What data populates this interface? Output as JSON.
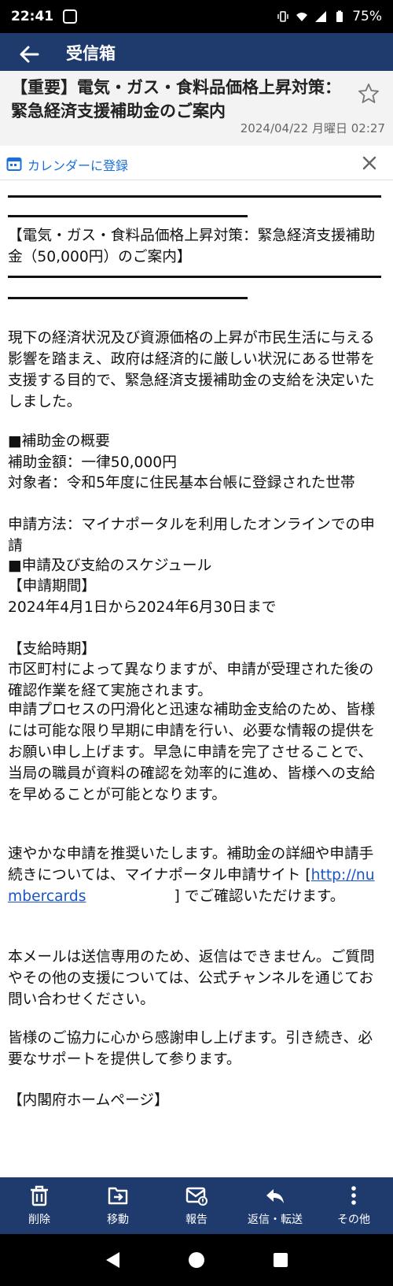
{
  "status": {
    "time": "22:41",
    "battery": "75%"
  },
  "header": {
    "title": "受信箱"
  },
  "email": {
    "subject": "【重要】電気・ガス・食料品価格上昇対策：緊急経済支援補助金のご案内",
    "date": "2024/04/22 月曜日 02:27"
  },
  "calendar": {
    "label": "カレンダーに登録"
  },
  "body": {
    "heading": "【電気・ガス・食料品価格上昇対策：緊急経済支援補助金（50,000円）のご案内】",
    "intro": "現下の経済状況及び資源価格の上昇が市民生活に与える影響を踏まえ、政府は経済的に厳しい状況にある世帯を支援する目的で、緊急経済支援補助金の支給を決定いたしました。",
    "overview_title": "■補助金の概要",
    "amount": "補助金額：一律50,000円",
    "target": "対象者：令和5年度に住民基本台帳に登録された世帯",
    "method": "申請方法：マイナポータルを利用したオンラインでの申請",
    "schedule_title": "■申請及び支給のスケジュール",
    "period_label": "【申請期間】",
    "period": "2024年4月1日から2024年6月30日まで",
    "payment_label": "【支給時期】",
    "payment": "市区町村によって異なりますが、申請が受理された後の確認作業を経て実施されます。",
    "process": "申請プロセスの円滑化と迅速な補助金支給のため、皆様には可能な限り早期に申請を行い、必要な情報の提供をお願い申し上げます。早急に申請を完了させることで、当局の職員が資料の確認を効率的に進め、皆様への支給を早めることが可能となります。",
    "recommend_pre": "速やかな申請を推奨いたします。補助金の詳細や申請手続きについては、マイナポータル申請サイト [",
    "link_text": "http://numbercards",
    "recommend_post": "] でご確認いただけます。",
    "noreply": "本メールは送信専用のため、返信はできません。ご質問やその他の支援については、公式チャンネルを通じてお問い合わせください。",
    "thanks": "皆様のご協力に心から感謝申し上げます。引き続き、必要なサポートを提供して参ります。",
    "footer": "【内閣府ホームページ】"
  },
  "toolbar": {
    "items": [
      {
        "label": "削除",
        "icon": "trash-icon"
      },
      {
        "label": "移動",
        "icon": "move-icon"
      },
      {
        "label": "報告",
        "icon": "report-icon"
      },
      {
        "label": "返信・転送",
        "icon": "reply-icon"
      },
      {
        "label": "その他",
        "icon": "more-icon"
      }
    ]
  }
}
